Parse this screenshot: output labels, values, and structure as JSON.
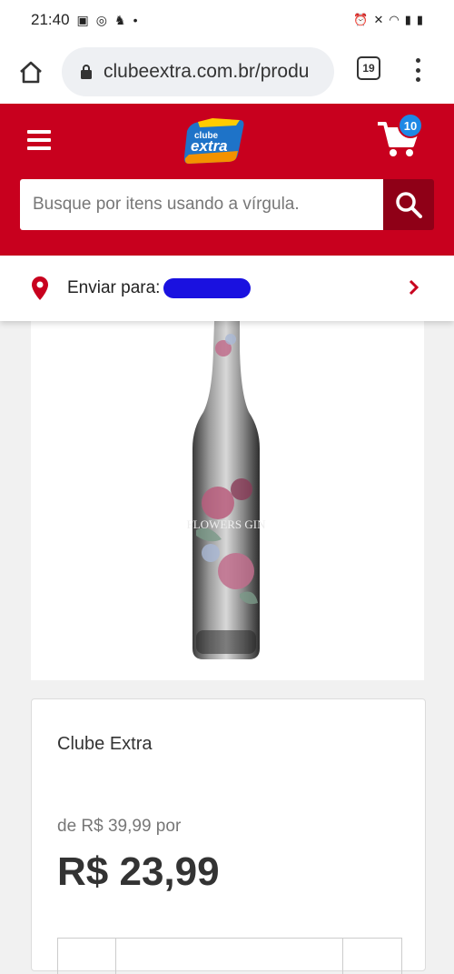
{
  "status_bar": {
    "time": "21:40"
  },
  "browser": {
    "url": "clubeextra.com.br/produ",
    "tab_count": "19"
  },
  "header": {
    "logo_line1": "clube",
    "logo_line2": "extra",
    "cart_count": "10",
    "search_placeholder": "Busque por itens usando a vírgula."
  },
  "shipping": {
    "label": "Enviar para:"
  },
  "product": {
    "bottle_text": "FLOWERS GIN",
    "brand": "Clube Extra",
    "old_price": "de R$ 39,99 por",
    "price": "R$ 23,99"
  },
  "colors": {
    "brand_red": "#c8001e",
    "search_button": "#8f0017",
    "badge_blue": "#1e88e5"
  }
}
